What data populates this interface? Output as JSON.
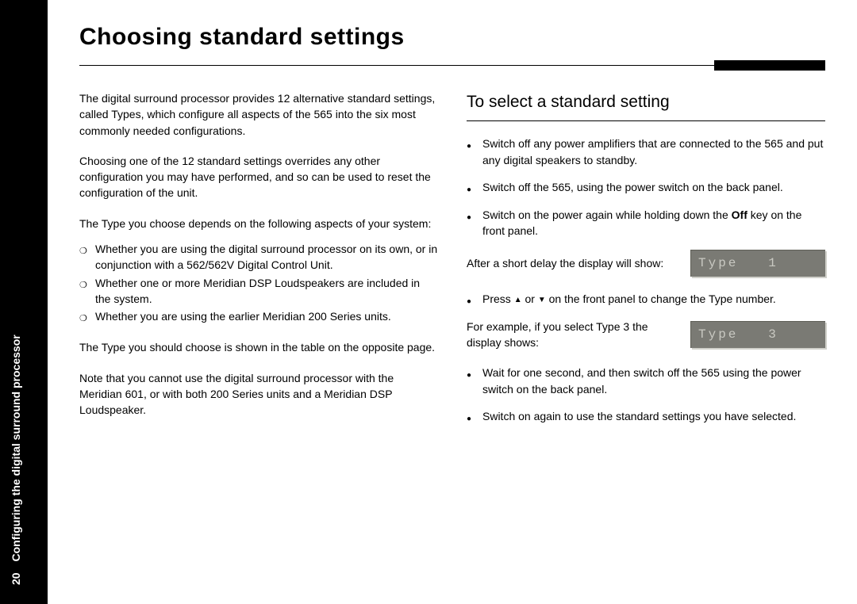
{
  "sidebar": {
    "page_number": "20",
    "section": "Configuring the digital surround processor"
  },
  "heading": "Choosing standard settings",
  "left": {
    "intro1": "The digital surround processor provides 12 alternative standard settings, called Types, which configure all aspects of the 565 into the six most commonly needed configurations.",
    "intro2": "Choosing one of the 12 standard settings overrides any other configuration you may have performed, and so can be used to reset the configuration of the unit.",
    "intro3": "The Type you choose depends on the following aspects of your system:",
    "bullets": [
      "Whether you are using the digital surround processor on its own, or in conjunction with a 562/562V Digital Control Unit.",
      "Whether one or more Meridian DSP Loudspeakers are included in the system.",
      "Whether you are using the earlier Meridian 200 Series units."
    ],
    "tail1": "The Type you should choose is shown in the table on the opposite page.",
    "tail2": "Note that you cannot use the digital surround processor with the Meridian 601, or with both 200 Series units and a Meridian DSP Loudspeaker."
  },
  "right": {
    "title": "To select a standard setting",
    "steps_a": [
      "Switch off any power amplifiers that are connected to the 565 and put any digital speakers to standby.",
      "Switch off the 565, using the power switch on the back panel."
    ],
    "step_off_pre": "Switch on the power again while holding down the ",
    "step_off_key": "Off",
    "step_off_post": " key on the front panel.",
    "after_delay": "After a short delay the display will show:",
    "display1": "Type   1",
    "press_pre": "Press ",
    "press_mid": " or ",
    "press_post": " on the front panel to change the Type number.",
    "example": "For example, if you select Type 3 the display shows:",
    "display2": "Type   3",
    "steps_b": [
      "Wait for one second, and then switch off the 565 using the power switch on the back panel.",
      "Switch on again to use the standard settings you have selected."
    ]
  }
}
